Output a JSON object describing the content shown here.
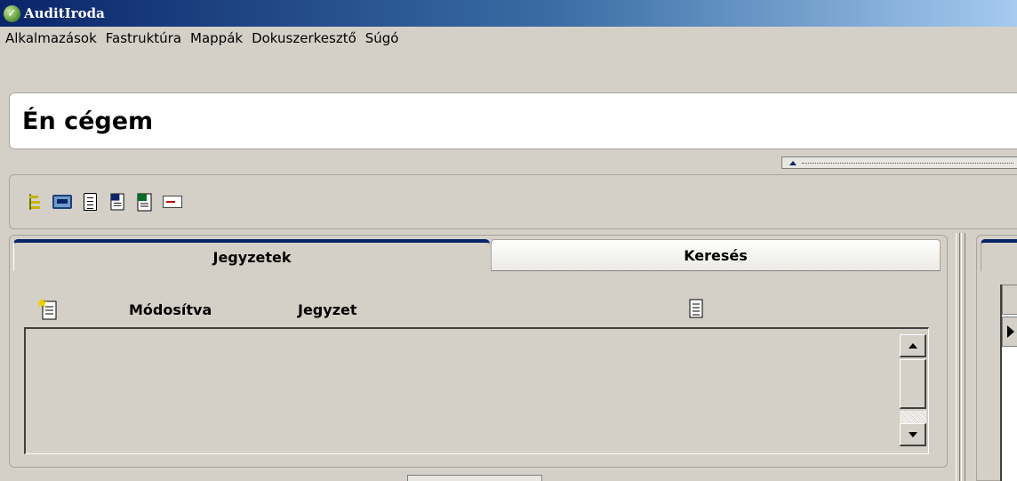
{
  "window": {
    "title": "AuditIroda",
    "icon": "checkmark-app-icon"
  },
  "menu": {
    "items": [
      {
        "label": "Alkalmazások"
      },
      {
        "label": "Fastruktúra"
      },
      {
        "label": "Mappák"
      },
      {
        "label": "Dokuszerkesztő"
      },
      {
        "label": "Súgó"
      }
    ]
  },
  "header": {
    "company_name": "Én cégem"
  },
  "toolbar": {
    "icons": [
      "tree-icon",
      "calculator-icon",
      "document-icon",
      "word-document-icon",
      "excel-document-icon",
      "envelope-icon"
    ]
  },
  "notes_panel": {
    "tabs": [
      {
        "label": "Jegyzetek",
        "active": true
      },
      {
        "label": "Keresés",
        "active": false
      }
    ],
    "columns": {
      "modified": "Módosítva",
      "note": "Jegyzet"
    },
    "rows": []
  },
  "colors": {
    "title_bar_start": "#0a246a",
    "title_bar_end": "#a6caf0",
    "active_tab_accent": "#0a246a",
    "window_bg": "#d4d0c8"
  }
}
